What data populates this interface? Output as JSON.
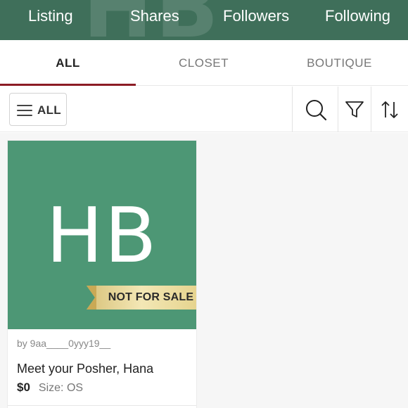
{
  "header": {
    "background_color": "#3f6f5a",
    "ghost_text": "HB",
    "stats": [
      {
        "label": "Listing"
      },
      {
        "label": "Shares"
      },
      {
        "label": "Followers"
      },
      {
        "label": "Following"
      }
    ]
  },
  "tabs": {
    "active_color": "#8c1c24",
    "items": [
      {
        "label": "ALL",
        "active": true
      },
      {
        "label": "CLOSET",
        "active": false
      },
      {
        "label": "BOUTIQUE",
        "active": false
      }
    ]
  },
  "toolbar": {
    "filter_all_label": "ALL",
    "icons": [
      "hamburger-icon",
      "search-icon",
      "filter-icon",
      "sort-icon"
    ]
  },
  "listings": [
    {
      "image_text": "HB",
      "image_background": "#4d9775",
      "badge": "NOT FOR SALE",
      "seller": "by 9aa____0yyy19__",
      "title": "Meet your Posher, Hana",
      "price": "$0",
      "size": "Size: OS"
    }
  ]
}
